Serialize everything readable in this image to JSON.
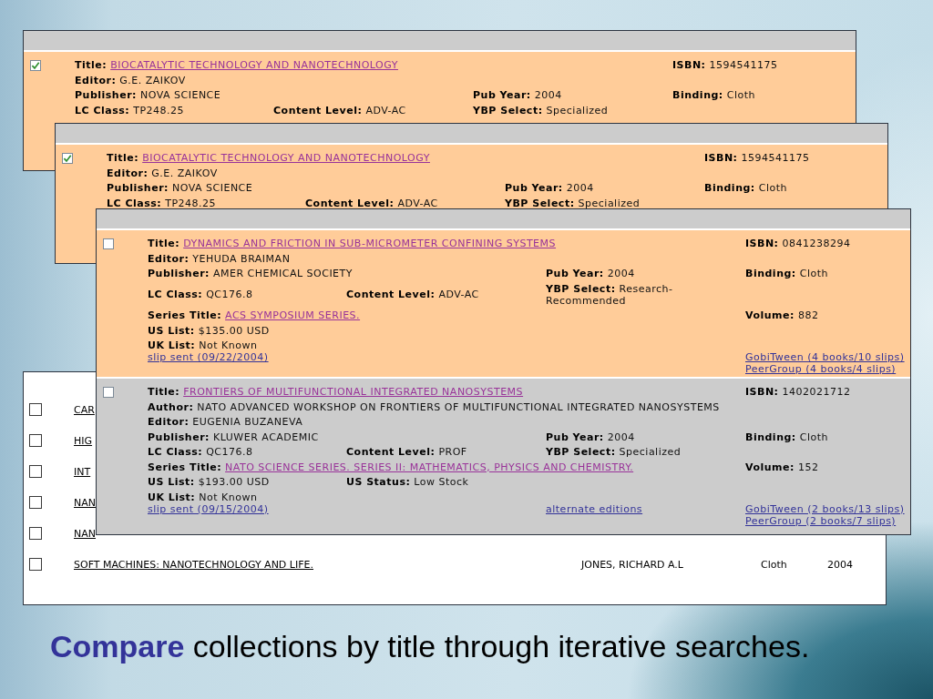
{
  "windows": [
    {
      "records": [
        {
          "checked": true,
          "color": "#ffcc99",
          "title": {
            "label": "Title:",
            "value": "BIOCATALYTIC TECHNOLOGY AND NANOTECHNOLOGY"
          },
          "isbn": {
            "label": "ISBN:",
            "value": "1594541175"
          },
          "editor": {
            "label": "Editor:",
            "value": "G.E. ZAIKOV"
          },
          "publisher": {
            "label": "Publisher:",
            "value": "NOVA SCIENCE"
          },
          "pub_year": {
            "label": "Pub Year:",
            "value": "2004"
          },
          "binding": {
            "label": "Binding:",
            "value": "Cloth"
          },
          "lc_class": {
            "label": "LC Class:",
            "value": "TP248.25"
          },
          "content_level": {
            "label": "Content Level:",
            "value": "ADV-AC"
          },
          "ybp_select": {
            "label": "YBP Select:",
            "value": "Specialized"
          }
        }
      ]
    },
    {
      "records": [
        {
          "checked": true,
          "color": "#ffcc99",
          "title": {
            "label": "Title:",
            "value": "BIOCATALYTIC TECHNOLOGY AND NANOTECHNOLOGY"
          },
          "isbn": {
            "label": "ISBN:",
            "value": "1594541175"
          },
          "editor": {
            "label": "Editor:",
            "value": "G.E. ZAIKOV"
          },
          "publisher": {
            "label": "Publisher:",
            "value": "NOVA SCIENCE"
          },
          "pub_year": {
            "label": "Pub Year:",
            "value": "2004"
          },
          "binding": {
            "label": "Binding:",
            "value": "Cloth"
          },
          "lc_class": {
            "label": "LC Class:",
            "value": "TP248.25"
          },
          "content_level": {
            "label": "Content Level:",
            "value": "ADV-AC"
          },
          "ybp_select": {
            "label": "YBP Select:",
            "value": "Specialized"
          }
        }
      ]
    },
    {
      "records": [
        {
          "checked": false,
          "color": "#ffcc99",
          "title": {
            "label": "Title:",
            "value": "DYNAMICS AND FRICTION IN SUB-MICROMETER CONFINING SYSTEMS"
          },
          "isbn": {
            "label": "ISBN:",
            "value": "0841238294"
          },
          "editor": {
            "label": "Editor:",
            "value": "YEHUDA BRAIMAN"
          },
          "publisher": {
            "label": "Publisher:",
            "value": "AMER CHEMICAL SOCIETY"
          },
          "pub_year": {
            "label": "Pub Year:",
            "value": "2004"
          },
          "binding": {
            "label": "Binding:",
            "value": "Cloth"
          },
          "lc_class": {
            "label": "LC Class:",
            "value": "QC176.8"
          },
          "content_level": {
            "label": "Content Level:",
            "value": "ADV-AC"
          },
          "ybp_select": {
            "label": "YBP Select:",
            "value": "Research-Recommended"
          },
          "series_title": {
            "label": "Series Title:",
            "value": "ACS SYMPOSIUM SERIES."
          },
          "volume": {
            "label": "Volume:",
            "value": "882"
          },
          "us_list": {
            "label": "US List:",
            "value": "$135.00 USD"
          },
          "uk_list": {
            "label": "UK List:",
            "value": "Not Known"
          },
          "slip_link": "slip sent (09/22/2004)",
          "gobitween_link": "GobiTween (4 books/10 slips)",
          "peergroup_link": "PeerGroup (4 books/4 slips)"
        },
        {
          "checked": false,
          "color": "#cccccc",
          "title": {
            "label": "Title:",
            "value": "FRONTIERS OF MULTIFUNCTIONAL INTEGRATED NANOSYSTEMS"
          },
          "isbn": {
            "label": "ISBN:",
            "value": "1402021712"
          },
          "author": {
            "label": "Author:",
            "value": "NATO ADVANCED WORKSHOP ON FRONTIERS OF MULTIFUNCTIONAL INTEGRATED NANOSYSTEMS"
          },
          "editor": {
            "label": "Editor:",
            "value": "EUGENIA BUZANEVA"
          },
          "publisher": {
            "label": "Publisher:",
            "value": "KLUWER ACADEMIC"
          },
          "pub_year": {
            "label": "Pub Year:",
            "value": "2004"
          },
          "binding": {
            "label": "Binding:",
            "value": "Cloth"
          },
          "lc_class": {
            "label": "LC Class:",
            "value": "QC176.8"
          },
          "content_level": {
            "label": "Content Level:",
            "value": "PROF"
          },
          "ybp_select": {
            "label": "YBP Select:",
            "value": "Specialized"
          },
          "series_title": {
            "label": "Series Title:",
            "value": "NATO SCIENCE SERIES. SERIES II: MATHEMATICS, PHYSICS AND CHEMISTRY."
          },
          "volume": {
            "label": "Volume:",
            "value": "152"
          },
          "us_list": {
            "label": "US List:",
            "value": "$193.00 USD"
          },
          "us_status": {
            "label": "US Status:",
            "value": "Low Stock"
          },
          "uk_list": {
            "label": "UK List:",
            "value": "Not Known"
          },
          "slip_link": "slip sent (09/15/2004)",
          "alternate_link": "alternate editions",
          "gobitween_link": "GobiTween (2 books/13 slips)",
          "peergroup_link": "PeerGroup (2 books/7 slips)"
        }
      ]
    }
  ],
  "results_list": {
    "rows": [
      {
        "checked": false,
        "title": "CAR"
      },
      {
        "checked": false,
        "title": "HIG"
      },
      {
        "checked": false,
        "title": "INT"
      },
      {
        "checked": false,
        "title": "NAN"
      },
      {
        "checked": false,
        "title": "NAN"
      },
      {
        "checked": false,
        "title": "SOFT MACHINES: NANOTECHNOLOGY AND LIFE.",
        "author": "JONES, RICHARD A.L",
        "binding": "Cloth",
        "year": "2004"
      }
    ]
  },
  "caption": "**Compare** collections by title through iterative searches."
}
